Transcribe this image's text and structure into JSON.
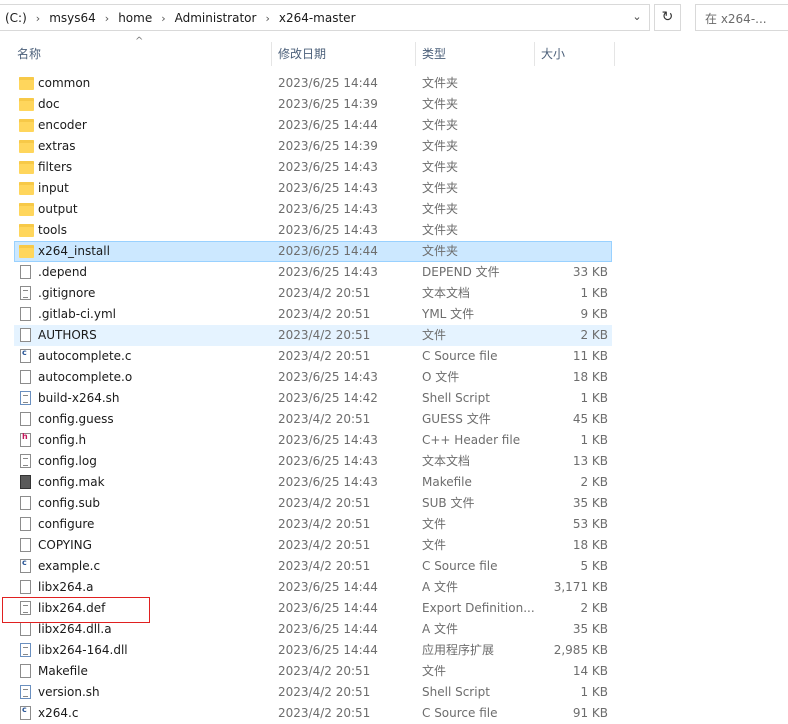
{
  "address": {
    "crumbs": [
      "(C:)",
      "msys64",
      "home",
      "Administrator",
      "x264-master"
    ],
    "search_placeholder": "在 x264-..."
  },
  "columns": {
    "name": "名称",
    "date": "修改日期",
    "type": "类型",
    "size": "大小"
  },
  "files": [
    {
      "name": "common",
      "date": "2023/6/25 14:44",
      "type": "文件夹",
      "size": "",
      "icon": "folder-icon",
      "state": ""
    },
    {
      "name": "doc",
      "date": "2023/6/25 14:39",
      "type": "文件夹",
      "size": "",
      "icon": "folder-icon",
      "state": ""
    },
    {
      "name": "encoder",
      "date": "2023/6/25 14:44",
      "type": "文件夹",
      "size": "",
      "icon": "folder-icon",
      "state": ""
    },
    {
      "name": "extras",
      "date": "2023/6/25 14:39",
      "type": "文件夹",
      "size": "",
      "icon": "folder-icon",
      "state": ""
    },
    {
      "name": "filters",
      "date": "2023/6/25 14:43",
      "type": "文件夹",
      "size": "",
      "icon": "folder-icon",
      "state": ""
    },
    {
      "name": "input",
      "date": "2023/6/25 14:43",
      "type": "文件夹",
      "size": "",
      "icon": "folder-icon",
      "state": ""
    },
    {
      "name": "output",
      "date": "2023/6/25 14:43",
      "type": "文件夹",
      "size": "",
      "icon": "folder-icon",
      "state": ""
    },
    {
      "name": "tools",
      "date": "2023/6/25 14:43",
      "type": "文件夹",
      "size": "",
      "icon": "folder-icon",
      "state": ""
    },
    {
      "name": "x264_install",
      "date": "2023/6/25 14:44",
      "type": "文件夹",
      "size": "",
      "icon": "folder-icon",
      "state": "selected"
    },
    {
      "name": ".depend",
      "date": "2023/6/25 14:43",
      "type": "DEPEND 文件",
      "size": "33 KB",
      "icon": "file-icon",
      "state": ""
    },
    {
      "name": ".gitignore",
      "date": "2023/4/2 20:51",
      "type": "文本文档",
      "size": "1 KB",
      "icon": "text-file-icon",
      "state": ""
    },
    {
      "name": ".gitlab-ci.yml",
      "date": "2023/4/2 20:51",
      "type": "YML 文件",
      "size": "9 KB",
      "icon": "file-icon",
      "state": ""
    },
    {
      "name": "AUTHORS",
      "date": "2023/4/2 20:51",
      "type": "文件",
      "size": "2 KB",
      "icon": "file-icon",
      "state": "hover"
    },
    {
      "name": "autocomplete.c",
      "date": "2023/4/2 20:51",
      "type": "C Source file",
      "size": "11 KB",
      "icon": "c-source-icon",
      "state": ""
    },
    {
      "name": "autocomplete.o",
      "date": "2023/6/25 14:43",
      "type": "O 文件",
      "size": "18 KB",
      "icon": "file-icon",
      "state": ""
    },
    {
      "name": "build-x264.sh",
      "date": "2023/6/25 14:42",
      "type": "Shell Script",
      "size": "1 KB",
      "icon": "shell-script-icon",
      "state": ""
    },
    {
      "name": "config.guess",
      "date": "2023/4/2 20:51",
      "type": "GUESS 文件",
      "size": "45 KB",
      "icon": "file-icon",
      "state": ""
    },
    {
      "name": "config.h",
      "date": "2023/6/25 14:43",
      "type": "C++ Header file",
      "size": "1 KB",
      "icon": "header-file-icon",
      "state": ""
    },
    {
      "name": "config.log",
      "date": "2023/6/25 14:43",
      "type": "文本文档",
      "size": "13 KB",
      "icon": "text-file-icon",
      "state": ""
    },
    {
      "name": "config.mak",
      "date": "2023/6/25 14:43",
      "type": "Makefile",
      "size": "2 KB",
      "icon": "makefile-icon",
      "state": ""
    },
    {
      "name": "config.sub",
      "date": "2023/4/2 20:51",
      "type": "SUB 文件",
      "size": "35 KB",
      "icon": "file-icon",
      "state": ""
    },
    {
      "name": "configure",
      "date": "2023/4/2 20:51",
      "type": "文件",
      "size": "53 KB",
      "icon": "file-icon",
      "state": ""
    },
    {
      "name": "COPYING",
      "date": "2023/4/2 20:51",
      "type": "文件",
      "size": "18 KB",
      "icon": "file-icon",
      "state": ""
    },
    {
      "name": "example.c",
      "date": "2023/4/2 20:51",
      "type": "C Source file",
      "size": "5 KB",
      "icon": "c-source-icon",
      "state": ""
    },
    {
      "name": "libx264.a",
      "date": "2023/6/25 14:44",
      "type": "A 文件",
      "size": "3,171 KB",
      "icon": "file-icon",
      "state": ""
    },
    {
      "name": "libx264.def",
      "date": "2023/6/25 14:44",
      "type": "Export Definition...",
      "size": "2 KB",
      "icon": "text-file-icon",
      "state": ""
    },
    {
      "name": "libx264.dll.a",
      "date": "2023/6/25 14:44",
      "type": "A 文件",
      "size": "35 KB",
      "icon": "file-icon",
      "state": ""
    },
    {
      "name": "libx264-164.dll",
      "date": "2023/6/25 14:44",
      "type": "应用程序扩展",
      "size": "2,985 KB",
      "icon": "dll-file-icon",
      "state": ""
    },
    {
      "name": "Makefile",
      "date": "2023/4/2 20:51",
      "type": "文件",
      "size": "14 KB",
      "icon": "file-icon",
      "state": ""
    },
    {
      "name": "version.sh",
      "date": "2023/4/2 20:51",
      "type": "Shell Script",
      "size": "1 KB",
      "icon": "shell-script-icon",
      "state": ""
    },
    {
      "name": "x264.c",
      "date": "2023/4/2 20:51",
      "type": "C Source file",
      "size": "91 KB",
      "icon": "c-source-icon",
      "state": ""
    }
  ],
  "colors": {
    "selection_bg": "#cce8ff",
    "selection_border": "#99d1ff",
    "hover_bg": "#e5f3ff",
    "folder": "#ffd65c",
    "highlight_box": "#e02020"
  }
}
